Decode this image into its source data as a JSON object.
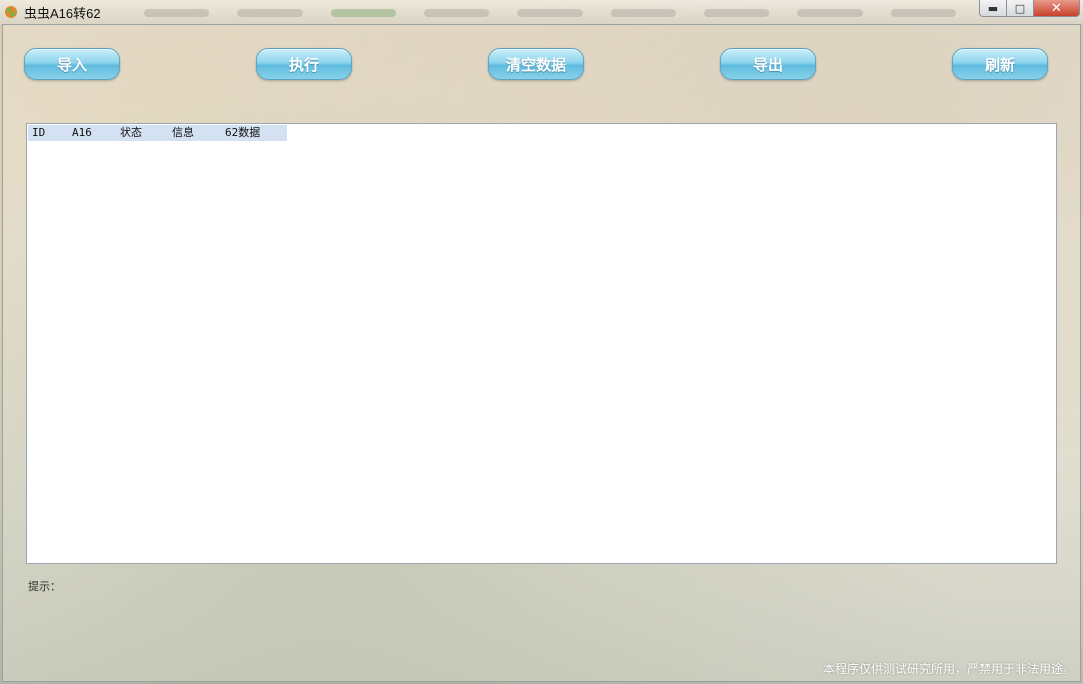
{
  "window": {
    "title": "虫虫A16转62",
    "close_glyph": "✕",
    "minimize_glyph": "▬",
    "maximize_glyph": "□"
  },
  "toolbar": {
    "import_label": "导入",
    "execute_label": "执行",
    "clear_label": "清空数据",
    "export_label": "导出",
    "refresh_label": "刷新"
  },
  "table": {
    "columns": [
      "ID",
      "A16",
      "状态",
      "信息",
      "62数据"
    ],
    "rows": []
  },
  "status": {
    "hint_label": "提示："
  },
  "footer": {
    "disclaimer": "本程序仅供测试研究所用，严禁用于非法用途。"
  },
  "colors": {
    "button_accent": "#5fbcdf",
    "header_bg": "#d3e1f3",
    "close_button": "#c8412c"
  }
}
